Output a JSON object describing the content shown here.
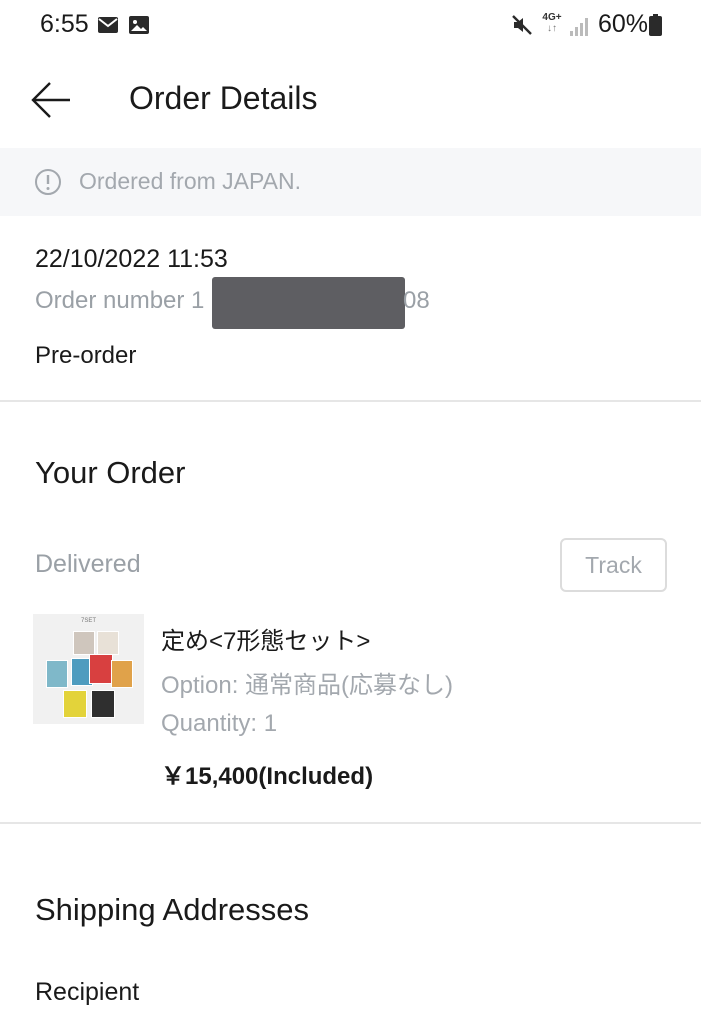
{
  "status_bar": {
    "time": "6:55",
    "network": "4G+",
    "battery": "60%"
  },
  "header": {
    "title": "Order Details"
  },
  "notice": {
    "text": "Ordered from JAPAN."
  },
  "order": {
    "date": "22/10/2022 11:53",
    "number_label": "Order number 1",
    "number_suffix": "08",
    "type": "Pre-order"
  },
  "your_order": {
    "title": "Your Order",
    "status": "Delivered",
    "track_label": "Track",
    "item": {
      "image_caption": "7SET",
      "name": "定め<7形態セット>",
      "option": "Option: 通常商品(応募なし)",
      "quantity": "Quantity: 1",
      "price": "￥15,400(Included)"
    }
  },
  "shipping": {
    "title": "Shipping Addresses",
    "recipient_label": "Recipient"
  },
  "colors": {
    "banner_bg": "#f6f7f9",
    "muted_text": "#a3a8ae",
    "divider": "#e6e6e6",
    "redaction": "#5e5e62"
  }
}
